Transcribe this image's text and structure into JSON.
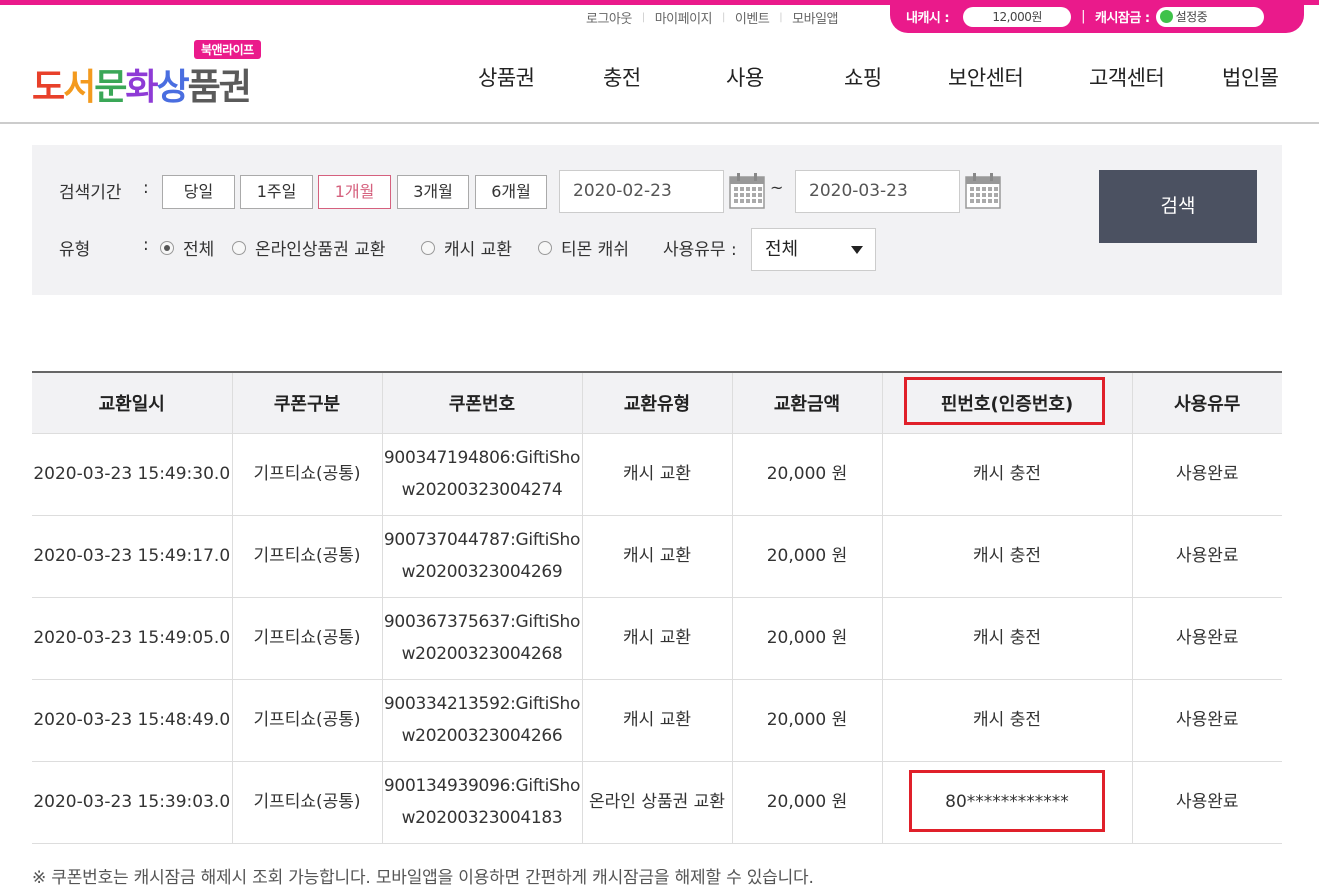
{
  "top_utility": {
    "links": [
      "로그아웃",
      "마이페이지",
      "이벤트",
      "모바일앱"
    ],
    "mycash_label": "내캐시 :",
    "mycash_value": "12,000원",
    "lock_label": "캐시잠금 :",
    "lock_status": "설정중",
    "accent_color": "#ea1a8b"
  },
  "logo": {
    "badge": "북앤라이프",
    "text": "도서문화상품권"
  },
  "gnb": [
    "상품권",
    "충전",
    "사용",
    "쇼핑",
    "보안센터",
    "고객센터",
    "법인몰"
  ],
  "search": {
    "period_label": "검색기간",
    "colon": ":",
    "periods": [
      "당일",
      "1주일",
      "1개월",
      "3개월",
      "6개월"
    ],
    "active_period": "1개월",
    "date_from": "2020-02-23",
    "date_to": "2020-03-23",
    "tilde": "~",
    "search_button": "검색",
    "type_label": "유형",
    "types": [
      "전체",
      "온라인상품권 교환",
      "캐시 교환",
      "티몬 캐쉬"
    ],
    "selected_type": "전체",
    "usage_label": "사용유무 :",
    "usage_value": "전체"
  },
  "table": {
    "headers": [
      "교환일시",
      "쿠폰구분",
      "쿠폰번호",
      "교환유형",
      "교환금액",
      "핀번호(인증번호)",
      "사용유무"
    ],
    "rows": [
      [
        "2020-03-23 15:49:30.0",
        "기프티쇼(공통)",
        "900347194806:GiftiShow20200323004274",
        "캐시 교환",
        "20,000 원",
        "캐시 충전",
        "사용완료"
      ],
      [
        "2020-03-23 15:49:17.0",
        "기프티쇼(공통)",
        "900737044787:GiftiShow20200323004269",
        "캐시 교환",
        "20,000 원",
        "캐시 충전",
        "사용완료"
      ],
      [
        "2020-03-23 15:49:05.0",
        "기프티쇼(공통)",
        "900367375637:GiftiShow20200323004268",
        "캐시 교환",
        "20,000 원",
        "캐시 충전",
        "사용완료"
      ],
      [
        "2020-03-23 15:48:49.0",
        "기프티쇼(공통)",
        "900334213592:GiftiShow20200323004266",
        "캐시 교환",
        "20,000 원",
        "캐시 충전",
        "사용완료"
      ],
      [
        "2020-03-23 15:39:03.0",
        "기프티쇼(공통)",
        "900134939096:GiftiShow20200323004183",
        "온라인 상품권 교환",
        "20,000 원",
        "80************",
        "사용완료"
      ]
    ]
  },
  "notice": "※ 쿠폰번호는 캐시잠금 해제시 조회 가능합니다. 모바일앱을 이용하면 간편하게 캐시잠금을 해제할 수 있습니다."
}
